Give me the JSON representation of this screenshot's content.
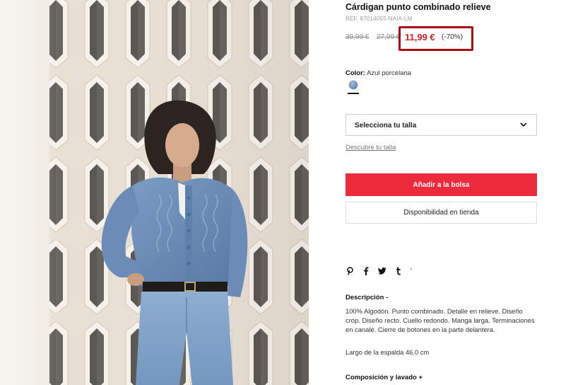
{
  "product": {
    "title": "Cárdigan punto combinado relieve",
    "ref": "REF. 87014055-NAIA-LM"
  },
  "price": {
    "original_1": "39,99 €",
    "original_2": "27,99 €",
    "current": "11,99 €",
    "discount": "(-70%)",
    "highlight_color": "#a80f14",
    "current_color": "#d81e2a"
  },
  "color": {
    "label": "Color:",
    "value": "Azul porcelana",
    "swatch_color": "#6f93b8"
  },
  "size": {
    "select_label": "Selecciona tu talla",
    "guide_link": "Descubre tu talla"
  },
  "actions": {
    "add_to_bag": "Añadir a la bolsa",
    "add_to_bag_color": "#ec2a3c",
    "store_availability": "Disponibilidad en tienda"
  },
  "share": {
    "icons": [
      "pinterest-icon",
      "facebook-icon",
      "twitter-icon",
      "tumblr-icon"
    ],
    "more": "'"
  },
  "description": {
    "heading": "Descripción  -",
    "body": "100% Algodón. Punto combinado. Detalle en relieve. Diseño crop. Diseño recto. Cuello redondo. Manga larga. Terminaciones en canalé. Cierre de botones en la parte delantera.",
    "back_length": "Largo de la espalda 46.0 cm"
  },
  "composition": {
    "heading": "Composición y lavado  +"
  }
}
